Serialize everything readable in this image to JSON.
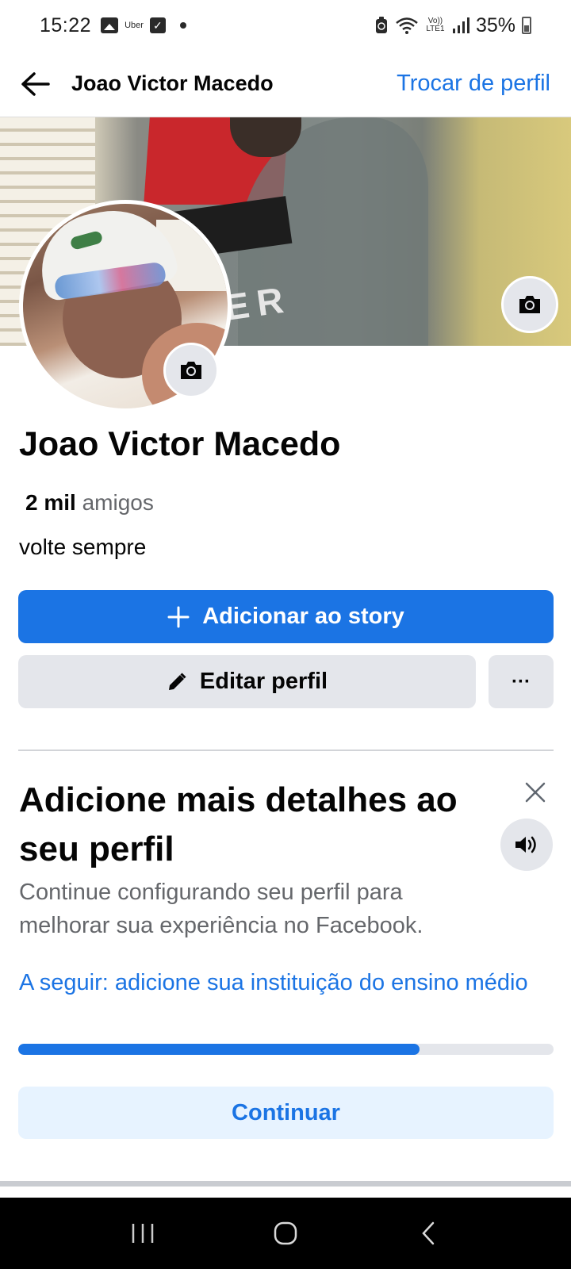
{
  "status_bar": {
    "time": "15:22",
    "notification_icons": [
      "image-icon",
      "uber-icon",
      "checkbox-icon",
      "dot-icon"
    ],
    "uber_label": "Uber",
    "lte_label": "Vo)) LTE1",
    "battery_percent": "35%"
  },
  "header": {
    "title": "Joao Victor Macedo",
    "switch_profile": "Trocar de perfil"
  },
  "cover": {
    "printed_text": "IGER"
  },
  "profile": {
    "name": "Joao Victor Macedo",
    "friends_count": "2 mil",
    "friends_label": "amigos",
    "bio": "volte sempre"
  },
  "actions": {
    "add_story": "Adicionar ao story",
    "edit_profile": "Editar perfil",
    "more": "···"
  },
  "details_card": {
    "title": "Adicione mais detalhes ao seu perfil",
    "description": "Continue configurando seu perfil para melhorar sua experiência no Facebook.",
    "next_step": "A seguir: adicione sua instituição do ensino médio",
    "progress_fraction": 0.75,
    "continue_label": "Continuar"
  },
  "colors": {
    "accent": "#1b74e4",
    "button_gray": "#e4e6eb",
    "secondary_text": "#65676b",
    "continue_bg": "#e7f3ff"
  },
  "nav_bar": {
    "icons": [
      "recent-apps-icon",
      "home-icon",
      "back-icon"
    ]
  }
}
